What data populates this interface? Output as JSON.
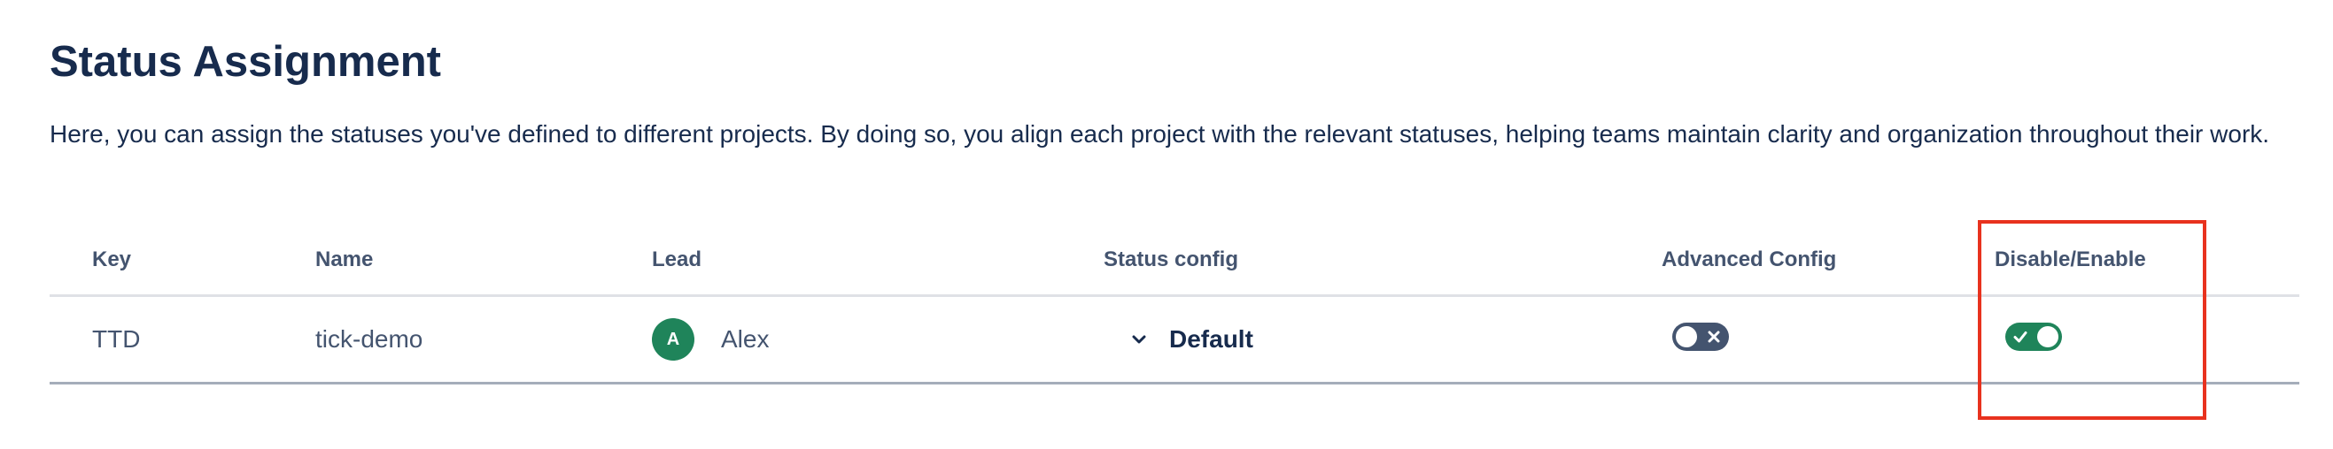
{
  "page": {
    "title": "Status Assignment",
    "description": "Here, you can assign the statuses you've defined to different projects. By doing so, you align each project with the relevant statuses, helping teams maintain clarity and organization throughout their work."
  },
  "table": {
    "headers": {
      "key": "Key",
      "name": "Name",
      "lead": "Lead",
      "status_config": "Status config",
      "advanced_config": "Advanced Config",
      "disable_enable": "Disable/Enable"
    },
    "rows": [
      {
        "key": "TTD",
        "name": "tick-demo",
        "lead_initial": "A",
        "lead_name": "Alex",
        "status_config": "Default",
        "advanced_config_enabled": false,
        "enabled": true
      }
    ]
  },
  "icons": {
    "status_dropdown": "chevron-down-icon",
    "toggle_off": "cross-icon",
    "toggle_on": "check-icon"
  },
  "colors": {
    "heading": "#172b4d",
    "header_text": "#44546f",
    "avatar_bg": "#1f845a",
    "toggle_on": "#1f845a",
    "toggle_off": "#44546f",
    "highlight": "#e8321e"
  }
}
